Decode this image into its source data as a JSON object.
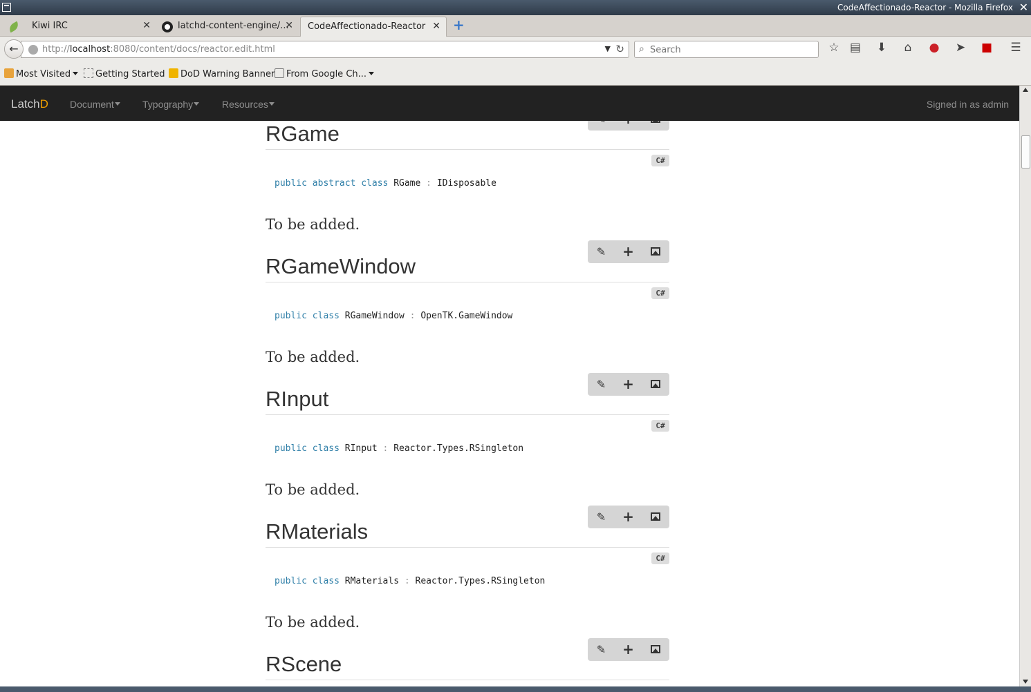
{
  "window": {
    "title": "CodeAffectionado-Reactor - Mozilla Firefox"
  },
  "tabs": [
    {
      "label": "Kiwi IRC",
      "icon": "kiwi-leaf-icon"
    },
    {
      "label": "latchd-content-engine/...",
      "icon": "github-icon"
    },
    {
      "label": "CodeAffectionado-Reactor",
      "active": true
    }
  ],
  "url": {
    "protocol": "http://",
    "host": "localhost",
    "rest": ":8080/content/docs/reactor.edit.html"
  },
  "search": {
    "placeholder": "Search"
  },
  "bookmarks": [
    {
      "label": "Most Visited",
      "dropdown": true
    },
    {
      "label": "Getting Started"
    },
    {
      "label": "DoD Warning Banner"
    },
    {
      "label": "From Google Ch...",
      "dropdown": true
    }
  ],
  "app": {
    "brand_main": "Latch",
    "brand_accent": "D",
    "accent_color": "#f0a000",
    "nav": [
      "Document",
      "Typography",
      "Resources"
    ],
    "user": "Signed in as admin"
  },
  "sections": [
    {
      "title": "RGame",
      "lang": "C#",
      "kw": "public abstract class",
      "name": "RGame",
      "sep": ":",
      "base": "IDisposable",
      "desc": "To be added."
    },
    {
      "title": "RGameWindow",
      "lang": "C#",
      "kw": "public class",
      "name": "RGameWindow",
      "sep": ":",
      "base": "OpenTK.GameWindow",
      "desc": "To be added."
    },
    {
      "title": "RInput",
      "lang": "C#",
      "kw": "public class",
      "name": "RInput",
      "sep": ":",
      "base": "Reactor.Types.RSingleton",
      "desc": "To be added."
    },
    {
      "title": "RMaterials",
      "lang": "C#",
      "kw": "public class",
      "name": "RMaterials",
      "sep": ":",
      "base": "Reactor.Types.RSingleton",
      "desc": "To be added."
    },
    {
      "title": "RScene",
      "lang": "C#",
      "kw": "",
      "name": "",
      "sep": "",
      "base": "",
      "desc": ""
    }
  ]
}
